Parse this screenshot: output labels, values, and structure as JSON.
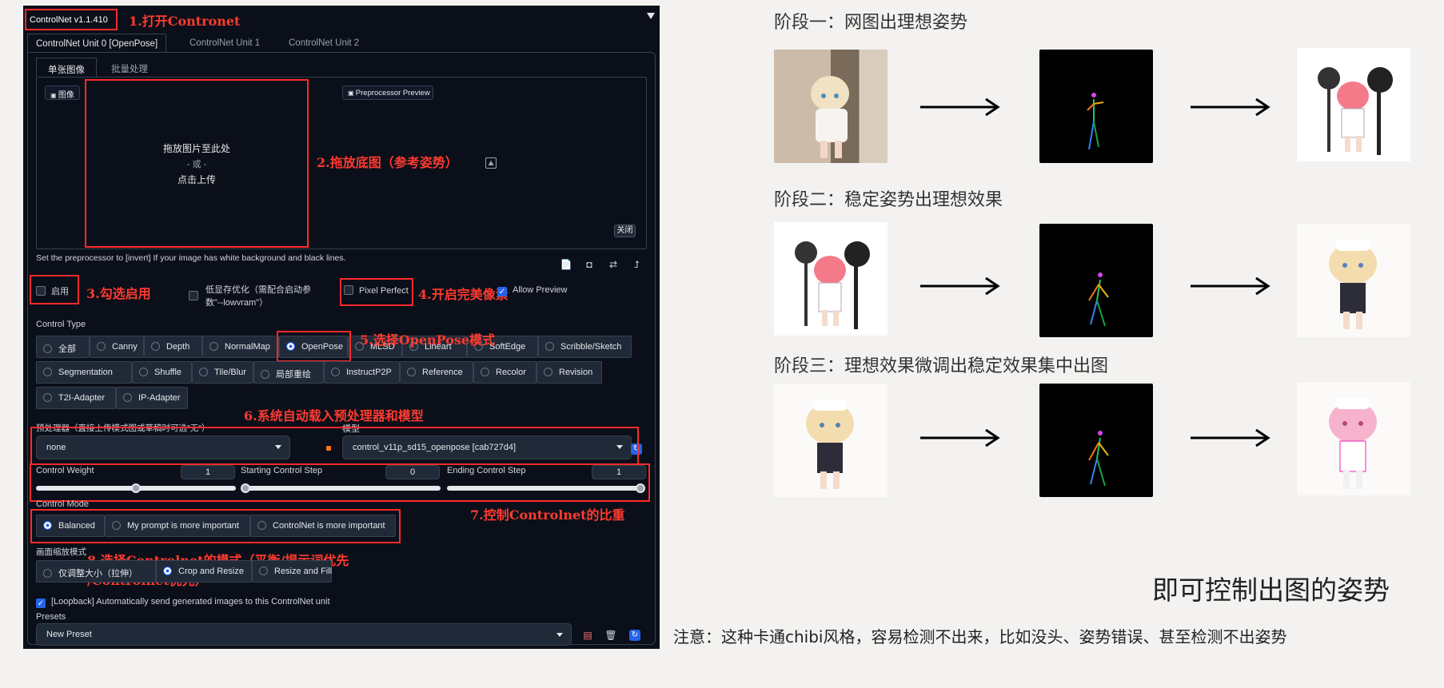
{
  "controlnet": {
    "title": "ControlNet v1.1.410",
    "collapse_icon": "triangle-down-icon",
    "unit_tabs": [
      "ControlNet Unit 0 [OpenPose]",
      "ControlNet Unit 1",
      "ControlNet Unit 2"
    ],
    "image_tabs": [
      "单张图像",
      "批量处理"
    ],
    "image_chip": "图像",
    "drop_text": "拖放图片至此处",
    "drop_or": "- 或 -",
    "drop_click": "点击上传",
    "preprocessor_preview": "Preprocessor Preview",
    "close_label": "关闭",
    "invert_hint": "Set the preprocessor to [invert] If your image has white background and black lines.",
    "enable_label": "启用",
    "lowvram_label_1": "低显存优化（需配合启动参",
    "lowvram_label_2": "数\"--lowvram\"）",
    "pixel_perfect_label": "Pixel Perfect",
    "allow_preview_label": "Allow Preview",
    "control_type_label": "Control Type",
    "control_types_row1": [
      "全部",
      "Canny",
      "Depth",
      "NormalMap",
      "OpenPose",
      "MLSD",
      "Lineart",
      "SoftEdge",
      "Scribble/Sketch"
    ],
    "control_types_row2": [
      "Segmentation",
      "Shuffle",
      "Tile/Blur",
      "局部重绘",
      "InstructP2P",
      "Reference",
      "Recolor",
      "Revision"
    ],
    "control_types_row3": [
      "T2I-Adapter",
      "IP-Adapter"
    ],
    "selected_control_type": "OpenPose",
    "preprocessor_label": "预处理器（直接上传模式图或草稿时可选\"无\"）",
    "preprocessor_value": "none",
    "model_label": "模型",
    "model_value": "control_v11p_sd15_openpose [cab727d4]",
    "control_weight_label": "Control Weight",
    "control_weight_value": "1",
    "control_weight": 1,
    "starting_step_label": "Starting Control Step",
    "starting_step_value": "0",
    "starting_step": 0,
    "ending_step_label": "Ending Control Step",
    "ending_step_value": "1",
    "ending_step": 1,
    "control_mode_label": "Control Mode",
    "control_modes": [
      "Balanced",
      "My prompt is more important",
      "ControlNet is more important"
    ],
    "selected_control_mode": "Balanced",
    "resize_mode_label": "画面缩放模式",
    "resize_modes": [
      "仅调整大小（拉伸）",
      "Crop and Resize",
      "Resize and Fill"
    ],
    "selected_resize_mode": "Crop and Resize",
    "loopback_label": "[Loopback] Automatically send generated images to this ControlNet unit",
    "presets_label": "Presets",
    "preset_value": "New Preset"
  },
  "annotations": {
    "a1": "1.打开Contronet",
    "a2": "2.拖放底图（参考姿势）",
    "a3": "3.勾选启用",
    "a4": "4.开启完美像素",
    "a5": "5.选择OpenPose模式",
    "a6": "6.系统自动载入预处理器和模型",
    "a7": "7.控制Controlnet的比重",
    "a8_1": "8.选择Controlnet的模式（平衡/提示词优先",
    "a8_2": "/Controlnet优先）"
  },
  "stages": [
    {
      "title": "阶段一：网图出理想姿势"
    },
    {
      "title": "阶段二：稳定姿势出理想效果"
    },
    {
      "title": "阶段三：理想效果微调出稳定效果集中出图"
    }
  ],
  "summary": "即可控制出图的姿势",
  "note": "注意：这种卡通chibi风格，容易检测不出来，比如没头、姿势错误、甚至检测不出姿势",
  "colors": {
    "accent_red": "#ff2a2a",
    "accent_blue": "#2563eb",
    "panel_bg": "#0b0f19"
  }
}
